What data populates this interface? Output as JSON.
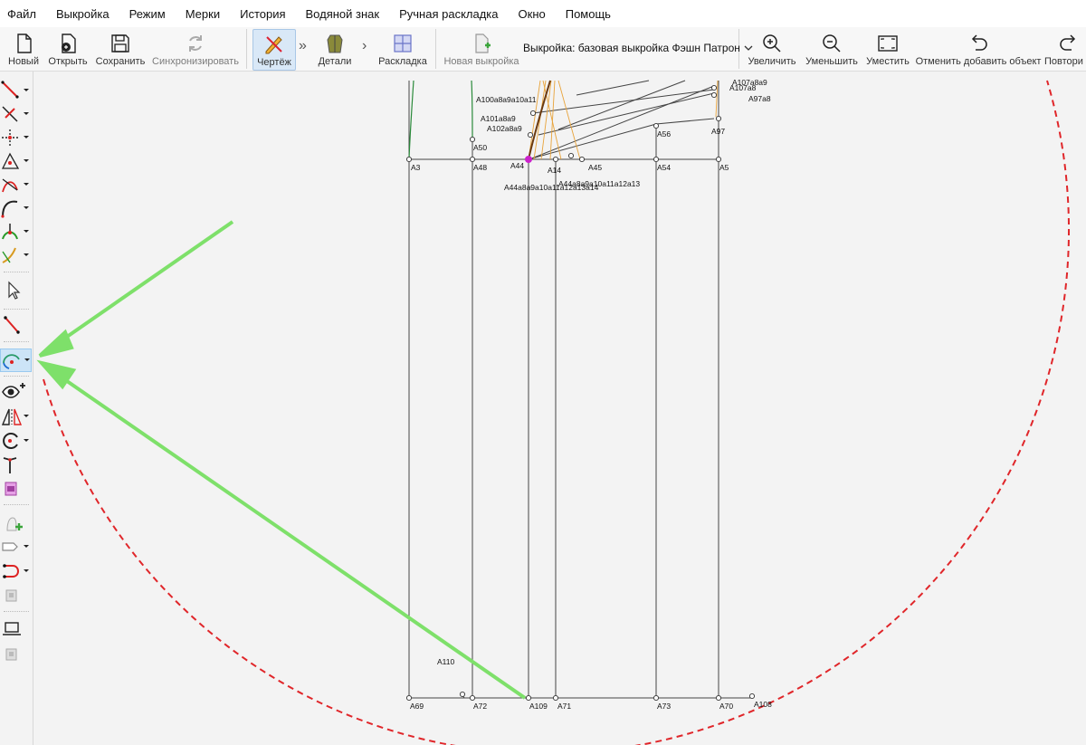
{
  "menu": [
    "Файл",
    "Выкройка",
    "Режим",
    "Мерки",
    "История",
    "Водяной знак",
    "Ручная раскладка",
    "Окно",
    "Помощь"
  ],
  "toolbar": {
    "new_label": "Новый",
    "open_label": "Открыть",
    "save_label": "Сохранить",
    "sync_label": "Синхронизировать",
    "draft_label": "Чертёж",
    "details_label": "Детали",
    "layout_label": "Раскладка",
    "new_pattern_label": "Новая выкройка",
    "pattern_select_value": "Выкройка: базовая выкройка Фэшн Патрон",
    "zoom_in_label": "Увеличить",
    "zoom_out_label": "Уменьшить",
    "fit_label": "Уместить",
    "undo_label": "Отменить добавить объект",
    "redo_label": "Повтори"
  },
  "left_tools": [
    "line-tool-icon",
    "point-on-line-tool-icon",
    "perpendicular-point-tool-icon",
    "triangle-tool-icon",
    "intersection-tool-icon",
    "curve-tool-icon",
    "arc-intersection-tool-icon",
    "spline-tool-icon",
    "pointer-tool-icon",
    "segment-tool-icon",
    "arc-with-radius-tool-icon",
    "visibility-group-icon",
    "mirror-tool-icon",
    "rotation-tool-icon",
    "true-dart-tool-icon",
    "export-picture-icon",
    "new-detail-icon",
    "detail-tool-icon",
    "path-tool-icon",
    "union-details-icon",
    "layout-settings-icon",
    "export-layout-icon"
  ],
  "selected_tool": "arc-with-radius-tool-icon",
  "canvas": {
    "labels": {
      "a3": "A3",
      "a48": "A48",
      "a50": "A50",
      "a56": "A56",
      "a97": "A97",
      "a97a8": "A97a8",
      "a5": "A5",
      "a54": "A54",
      "a45": "A45",
      "a14": "A14",
      "a44": "A44",
      "a100": "A100a8a9a10a11",
      "a101": "A101a8a9",
      "a102": "A102a8a9",
      "a107a": "A107a8a9",
      "a107b": "A107a8",
      "a44ext": "A44a8a9a10a11a12a13",
      "a44a": "A44a8a9a10a11a12a13a14",
      "a69": "A69",
      "a72": "A72",
      "a109": "A109",
      "a71": "A71",
      "a73": "A73",
      "a70": "A70",
      "a108": "A108",
      "a110": "A110"
    },
    "arc_color": "#e0262a",
    "arrow_color": "#7ee06a",
    "construction_color": "#e8a33a",
    "selected_point_color": "#cc22cc"
  }
}
